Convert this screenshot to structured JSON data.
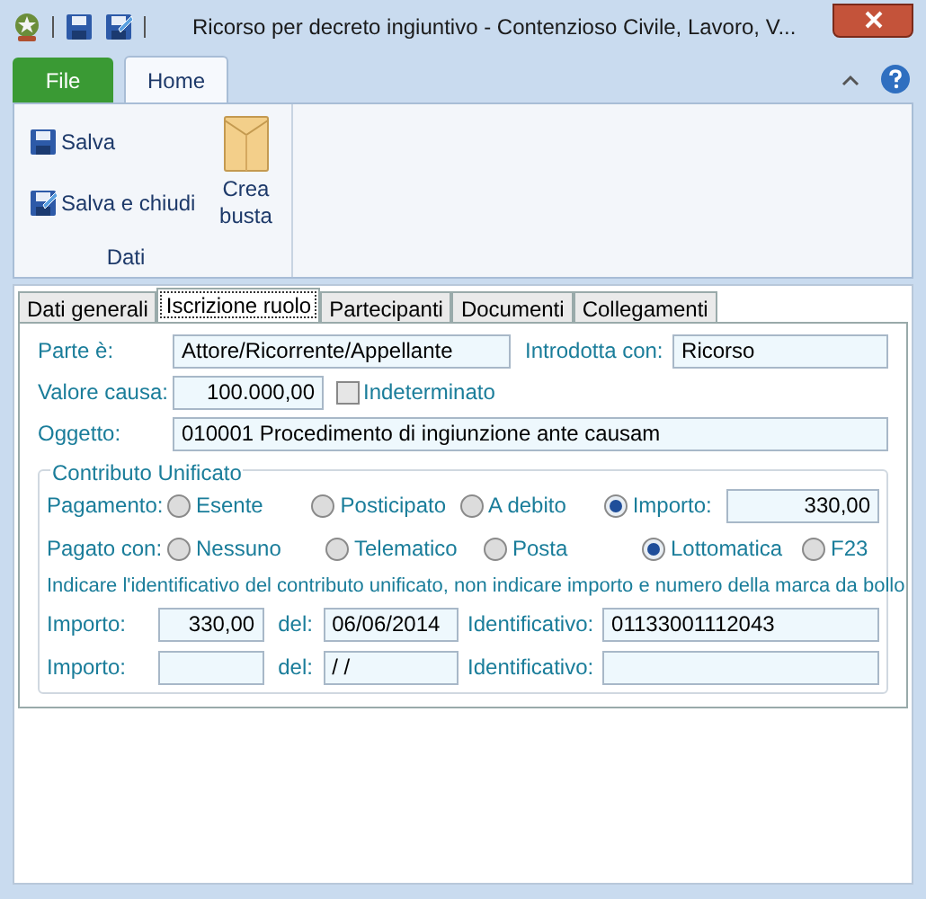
{
  "window": {
    "title": "Ricorso per decreto ingiuntivo - Contenzioso Civile, Lavoro, V..."
  },
  "ribbon": {
    "tabs": [
      {
        "label": "File",
        "kind": "file",
        "selected": false
      },
      {
        "label": "Home",
        "kind": "tab",
        "selected": true
      }
    ],
    "group": {
      "label": "Dati",
      "buttons": [
        {
          "label": "Salva",
          "kind": "small"
        },
        {
          "label": "Salva e chiudi",
          "kind": "small"
        },
        {
          "label": "Crea busta",
          "kind": "large"
        }
      ]
    }
  },
  "tabs": [
    {
      "label": "Dati generali",
      "selected": false
    },
    {
      "label": "Iscrizione ruolo",
      "selected": true
    },
    {
      "label": "Partecipanti",
      "selected": false
    },
    {
      "label": "Documenti",
      "selected": false
    },
    {
      "label": "Collegamenti",
      "selected": false
    }
  ],
  "form": {
    "parte": {
      "label": "Parte è:",
      "value": "Attore/Ricorrente/Appellante"
    },
    "introdotta": {
      "label": "Introdotta con:",
      "value": "Ricorso"
    },
    "valore": {
      "label": "Valore causa:",
      "value": "100.000,00"
    },
    "indeterminato": {
      "label": "Indeterminato",
      "checked": false
    },
    "oggetto": {
      "label": "Oggetto:",
      "value": "010001 Procedimento di ingiunzione ante causam"
    }
  },
  "contributo": {
    "title": "Contributo Unificato",
    "pagamento": {
      "label": "Pagamento:",
      "options": [
        {
          "label": "Esente",
          "selected": false
        },
        {
          "label": "Posticipato",
          "selected": false
        },
        {
          "label": "A debito",
          "selected": false
        },
        {
          "label": "Importo:",
          "selected": true
        }
      ],
      "importo": "330,00"
    },
    "pagato_con": {
      "label": "Pagato con:",
      "options": [
        {
          "label": "Nessuno",
          "selected": false
        },
        {
          "label": "Telematico",
          "selected": false
        },
        {
          "label": "Posta",
          "selected": false
        },
        {
          "label": "Lottomatica",
          "selected": true
        },
        {
          "label": "F23",
          "selected": false
        }
      ]
    },
    "note": "Indicare l'identificativo del contributo unificato, non indicare importo e numero della marca da bollo",
    "rows": [
      {
        "importo_label": "Importo:",
        "importo": "330,00",
        "del_label": "del:",
        "del": "06/06/2014",
        "id_label": "Identificativo:",
        "id": "01133001112043"
      },
      {
        "importo_label": "Importo:",
        "del_label": "del:",
        "del": " / /",
        "id_label": "Identificativo:"
      }
    ]
  }
}
